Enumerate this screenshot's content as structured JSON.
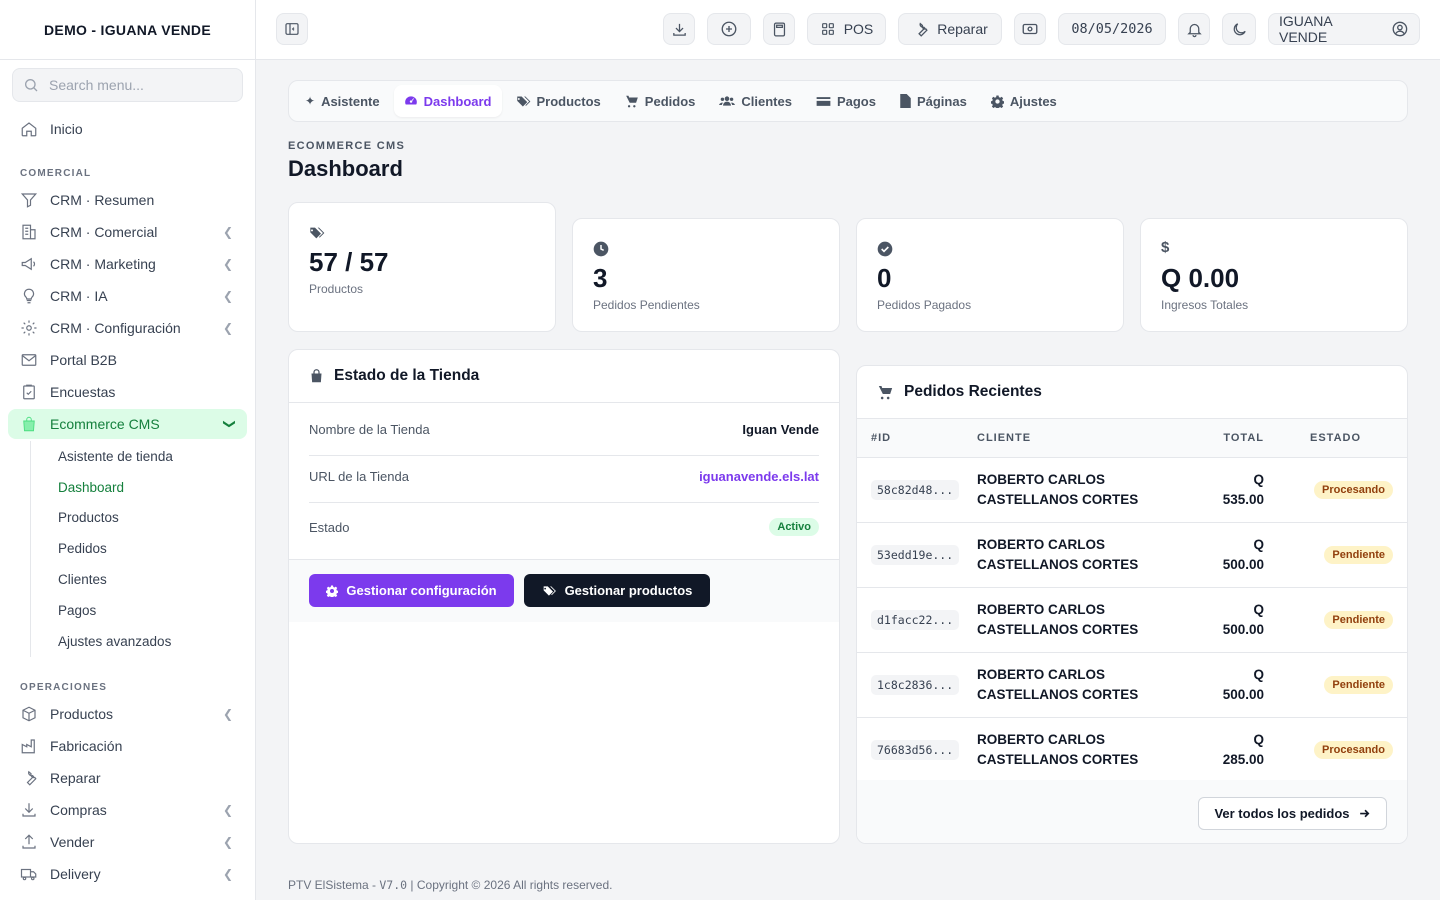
{
  "sidebar": {
    "brand": "DEMO - IGUANA VENDE",
    "search_placeholder": "Search menu...",
    "home": "Inicio",
    "section_comercial": "COMERCIAL",
    "comercial_items": [
      "CRM · Resumen",
      "CRM · Comercial",
      "CRM · Marketing",
      "CRM · IA",
      "CRM · Configuración",
      "Portal B2B",
      "Encuestas",
      "Ecommerce CMS"
    ],
    "ecommerce_sub": [
      "Asistente de tienda",
      "Dashboard",
      "Productos",
      "Pedidos",
      "Clientes",
      "Pagos",
      "Ajustes avanzados"
    ],
    "section_operaciones": "OPERACIONES",
    "operaciones_items": [
      "Productos",
      "Fabricación",
      "Reparar",
      "Compras",
      "Vender",
      "Delivery"
    ]
  },
  "topbar": {
    "pos": "POS",
    "repair": "Reparar",
    "date": "08/05/2026",
    "user": "IGUANA VENDE"
  },
  "tabs": [
    "Asistente",
    "Dashboard",
    "Productos",
    "Pedidos",
    "Clientes",
    "Pagos",
    "Páginas",
    "Ajustes"
  ],
  "page": {
    "eyebrow": "ECOMMERCE CMS",
    "title": "Dashboard"
  },
  "stats": [
    {
      "value": "57 / 57",
      "label": "Productos"
    },
    {
      "value": "3",
      "label": "Pedidos Pendientes"
    },
    {
      "value": "0",
      "label": "Pedidos Pagados"
    },
    {
      "value": "Q 0.00",
      "label": "Ingresos Totales"
    }
  ],
  "store": {
    "title": "Estado de la Tienda",
    "name_label": "Nombre de la Tienda",
    "name_value": "Iguan Vende",
    "url_label": "URL de la Tienda",
    "url_value": "iguanavende.els.lat",
    "status_label": "Estado",
    "status_value": "Activo",
    "btn_config": "Gestionar configuración",
    "btn_products": "Gestionar productos"
  },
  "orders": {
    "title": "Pedidos Recientes",
    "headers": [
      "#ID",
      "CLIENTE",
      "TOTAL",
      "ESTADO"
    ],
    "rows": [
      {
        "id": "58c82d48...",
        "client_line1": "ROBERTO CARLOS",
        "client_line2": "CASTELLANOS CORTES",
        "currency": "Q",
        "amount": "535.00",
        "status": "Procesando"
      },
      {
        "id": "53edd19e...",
        "client_line1": "ROBERTO CARLOS",
        "client_line2": "CASTELLANOS CORTES",
        "currency": "Q",
        "amount": "500.00",
        "status": "Pendiente"
      },
      {
        "id": "d1facc22...",
        "client_line1": "ROBERTO CARLOS",
        "client_line2": "CASTELLANOS CORTES",
        "currency": "Q",
        "amount": "500.00",
        "status": "Pendiente"
      },
      {
        "id": "1c8c2836...",
        "client_line1": "ROBERTO CARLOS",
        "client_line2": "CASTELLANOS CORTES",
        "currency": "Q",
        "amount": "500.00",
        "status": "Pendiente"
      },
      {
        "id": "76683d56...",
        "client_line1": "ROBERTO CARLOS",
        "client_line2": "CASTELLANOS CORTES",
        "currency": "Q",
        "amount": "285.00",
        "status": "Procesando"
      }
    ],
    "view_all": "Ver todos los pedidos"
  },
  "footer": {
    "prefix": "PTV ElSistema - ",
    "version": "V7.0",
    "suffix": " | Copyright © 2026 All rights reserved."
  },
  "colors": {
    "accent": "#7c3aed",
    "active_green": "#15803d",
    "dark_button": "#111827"
  }
}
